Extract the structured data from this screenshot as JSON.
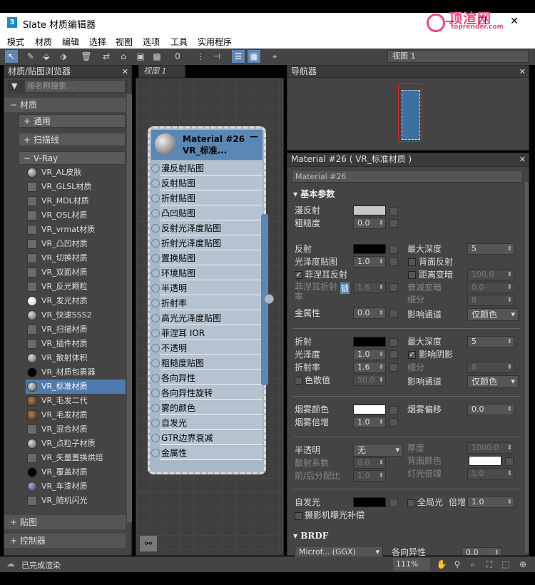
{
  "window": {
    "title": "Slate 材质编辑器",
    "app_icon": "3"
  },
  "watermark": {
    "line1": "顶渲网",
    "line2": "toprender.com"
  },
  "menu": [
    "模式",
    "材质",
    "编辑",
    "选择",
    "视图",
    "选项",
    "工具",
    "实用程序"
  ],
  "toolbar": {
    "view_select": "视图 1"
  },
  "browser": {
    "title": "材质/贴图浏览器",
    "search_placeholder": "按名称搜索...",
    "section_materials": "材质",
    "sub_general": "通用",
    "sub_scanline": "扫描线",
    "sub_vray": "V-Ray",
    "items": [
      {
        "label": "VR_AL皮肤",
        "swatch": "ball"
      },
      {
        "label": "VR_GLSL材质",
        "swatch": "flat"
      },
      {
        "label": "VR_MDL材质",
        "swatch": "flat"
      },
      {
        "label": "VR_OSL材质",
        "swatch": "flat"
      },
      {
        "label": "VR_vrmat材质",
        "swatch": "flat"
      },
      {
        "label": "VR_凸凹材质",
        "swatch": "flat"
      },
      {
        "label": "VR_切换材质",
        "swatch": "flat"
      },
      {
        "label": "VR_双面材质",
        "swatch": "flat"
      },
      {
        "label": "VR_反光颗粒",
        "swatch": "flat"
      },
      {
        "label": "VR_发光材质",
        "swatch": "white"
      },
      {
        "label": "VR_快速SSS2",
        "swatch": "ball"
      },
      {
        "label": "VR_扫描材质",
        "swatch": "flat"
      },
      {
        "label": "VR_插件材质",
        "swatch": "flat"
      },
      {
        "label": "VR_散射体积",
        "swatch": "ball"
      },
      {
        "label": "VR_材质包裹器",
        "swatch": "black"
      },
      {
        "label": "VR_标准材质",
        "swatch": "ball",
        "selected": true
      },
      {
        "label": "VR_毛发二代",
        "swatch": "brown"
      },
      {
        "label": "VR_毛发材质",
        "swatch": "brown"
      },
      {
        "label": "VR_混合材质",
        "swatch": "flat"
      },
      {
        "label": "VR_点粒子材质",
        "swatch": "ball"
      },
      {
        "label": "VR_矢量置换烘焙",
        "swatch": "flat"
      },
      {
        "label": "VR_覆盖材质",
        "swatch": "black"
      },
      {
        "label": "VR_车漆材质",
        "swatch": "car"
      },
      {
        "label": "VR_随机闪光",
        "swatch": "flat"
      }
    ],
    "section_maps": "贴图",
    "section_controllers": "控制器"
  },
  "view": {
    "tab": "视图 1"
  },
  "node": {
    "title1": "Material #26",
    "title2": "VR_标准...",
    "slots": [
      "漫反射贴图",
      "反射贴图",
      "折射贴图",
      "凸凹贴图",
      "反射光泽度贴图",
      "折射光泽度贴图",
      "置换贴图",
      "环境贴图",
      "半透明",
      "折射率",
      "高光光泽度贴图",
      "菲涅耳 IOR",
      "不透明",
      "粗糙度贴图",
      "各向异性",
      "各向异性旋转",
      "雾的颜色",
      "自发光",
      "GTR边界衰减",
      "金属性"
    ]
  },
  "navigator": {
    "title": "导航器"
  },
  "params": {
    "title": "Material #26  ( VR_标准材质 )",
    "name": "Material #26",
    "rollout_basic": "基本参数",
    "diffuse": "漫反射",
    "roughness": "粗糙度",
    "roughness_val": "0.0",
    "reflect": "反射",
    "max_depth": "最大深度",
    "refl_depth_val": "5",
    "gloss": "光泽度贴图",
    "gloss_val": "1.0",
    "back_reflect": "背面反射",
    "fresnel": "菲涅耳反射",
    "dim_dist": "距离变暗",
    "dim_dist_val": "100.0",
    "fresnel_ior": "菲涅耳折射率",
    "lock": "锁",
    "fresnel_ior_val": "1.6",
    "dim_falloff": "衰减变暗",
    "dim_falloff_val": "0.0",
    "subdiv": "细分",
    "subdiv_val": "8",
    "metal": "金属性",
    "metal_val": "0.0",
    "affect_ch": "影响通道",
    "color_only": "仅颜色",
    "refract": "折射",
    "refr_depth_val": "5",
    "refr_gloss": "光泽度",
    "refr_gloss_val": "1.0",
    "affect_shadow": "影响阴影",
    "ior": "折射率",
    "ior_val": "1.6",
    "refr_subdiv_val": "8",
    "dispersion": "色散值",
    "dispersion_val": "50.0",
    "fog_color": "烟雾颜色",
    "fog_bias": "烟雾偏移",
    "fog_bias_val": "0.0",
    "fog_mult": "烟雾倍增",
    "fog_mult_val": "1.0",
    "translucency": "半透明",
    "trans_mode": "无",
    "thickness": "厚度",
    "thickness_val": "1000.0",
    "scatter": "散射系数",
    "scatter_val": "0.0",
    "back_color": "背面颜色",
    "fb_coeff": "前/后分配比",
    "fb_val": "1.0",
    "light_mult": "灯光倍增",
    "light_mult_val": "1.0",
    "self_illum": "自发光",
    "gi": "全局光",
    "mult": "倍增",
    "mult_val": "1.0",
    "cam_exp": "摄影机曝光补偿",
    "rollout_brdf": "BRDF",
    "brdf_type": "Microf... (GGX)",
    "aniso": "各向异性",
    "aniso_val": "0.0"
  },
  "status": {
    "text": "已完成渲染",
    "zoom": "111%"
  },
  "colors": {
    "accent": "#5a87b4",
    "panel": "#444444",
    "node": "#a9b8c6"
  }
}
